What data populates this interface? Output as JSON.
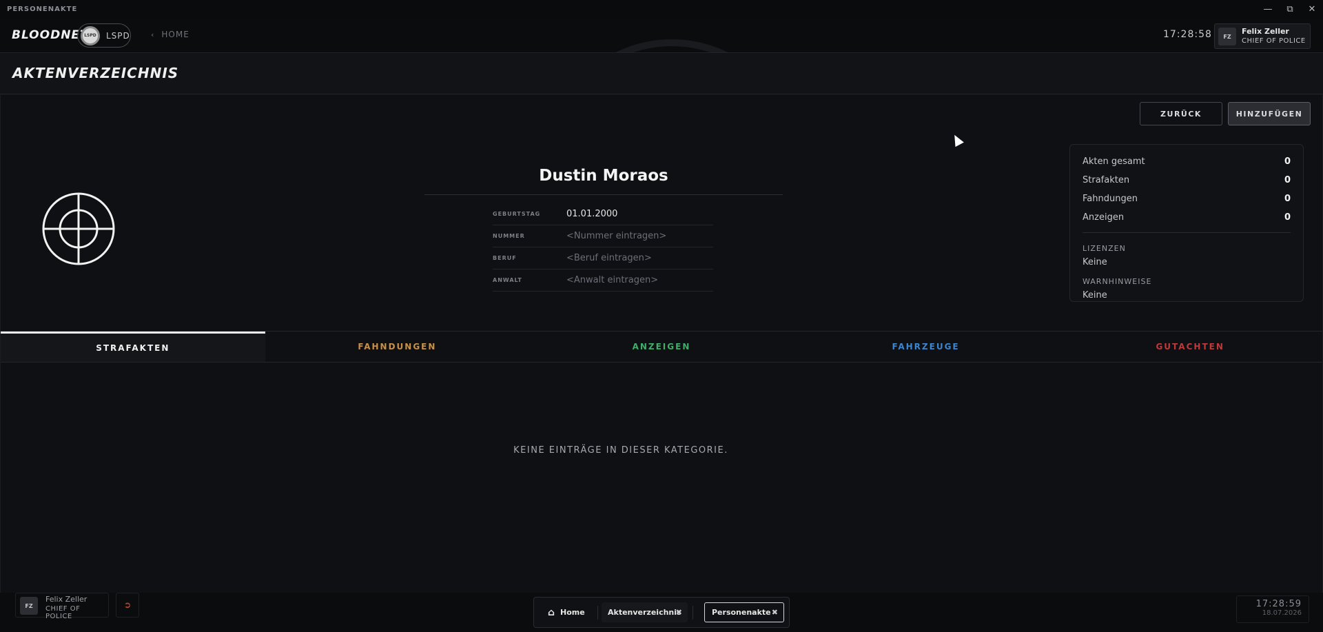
{
  "window": {
    "title": "PERSONENAKTE",
    "controls": [
      "minimize-icon",
      "restore-icon",
      "close-icon"
    ]
  },
  "header": {
    "brand": "BLOODNET",
    "org": {
      "name": "LSPD",
      "seal": "LSPD"
    },
    "nav": {
      "home_label": "HOME"
    },
    "clock": "17:28:58",
    "user": {
      "initials": "FZ",
      "name": "Felix Zeller",
      "rank": "CHIEF OF POLICE"
    }
  },
  "page": {
    "title": "AKTENVERZEICHNIS"
  },
  "actions": {
    "back_label": "ZURÜCK",
    "add_label": "HINZUFÜGEN"
  },
  "person": {
    "name": "Dustin Moraos",
    "fields": [
      {
        "label": "GEBURTSTAG",
        "value": "01.01.2000",
        "placeholder": false
      },
      {
        "label": "NUMMER",
        "value": "<Nummer eintragen>",
        "placeholder": true
      },
      {
        "label": "BERUF",
        "value": "<Beruf eintragen>",
        "placeholder": true
      },
      {
        "label": "ANWALT",
        "value": "<Anwalt eintragen>",
        "placeholder": true
      }
    ]
  },
  "stats": {
    "rows": [
      {
        "label": "Akten gesamt",
        "value": "0"
      },
      {
        "label": "Strafakten",
        "value": "0"
      },
      {
        "label": "Fahndungen",
        "value": "0"
      },
      {
        "label": "Anzeigen",
        "value": "0"
      }
    ],
    "licenses_label": "LIZENZEN",
    "licenses_value": "Keine",
    "warnings_label": "WARNHINWEISE",
    "warnings_value": "Keine"
  },
  "tabs": [
    {
      "label": "STRAFAKTEN",
      "color": "#f2f2f2",
      "active": true
    },
    {
      "label": "FAHNDUNGEN",
      "color": "#c8914a",
      "active": false
    },
    {
      "label": "ANZEIGEN",
      "color": "#3fae6a",
      "active": false
    },
    {
      "label": "FAHRZEUGE",
      "color": "#3a86d0",
      "active": false
    },
    {
      "label": "GUTACHTEN",
      "color": "#c0393a",
      "active": false
    }
  ],
  "empty_message": "KEINE EINTRÄGE IN DIESER KATEGORIE.",
  "taskbar": {
    "user": {
      "initials": "FZ",
      "name": "Felix Zeller",
      "rank": "CHIEF OF POLICE"
    },
    "dock": [
      {
        "label": "Home",
        "closable": false
      },
      {
        "label": "Aktenverzeichnis",
        "closable": true
      },
      {
        "label": "Personenakte",
        "closable": true
      }
    ],
    "clock": {
      "time": "17:28:59",
      "date": "18.07.2026"
    }
  }
}
